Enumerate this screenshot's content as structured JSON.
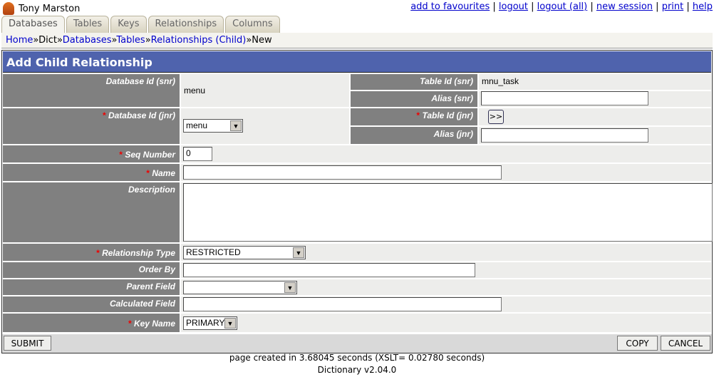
{
  "user": {
    "name": "Tony Marston"
  },
  "top_links": [
    "add to favourites",
    "logout",
    "logout (all)",
    "new session",
    "print",
    "help"
  ],
  "tabs": [
    "Databases",
    "Tables",
    "Keys",
    "Relationships",
    "Columns"
  ],
  "breadcrumb": {
    "home": "Home",
    "dict": "Dict",
    "databases": "Databases",
    "tables": "Tables",
    "relationships": "Relationships (Child)",
    "current": "New",
    "sep": "»"
  },
  "title": "Add Child Relationship",
  "form": {
    "db_snr_label": "Database Id (snr)",
    "db_snr_value": "menu",
    "table_snr_label": "Table Id (snr)",
    "table_snr_value": "mnu_task",
    "alias_snr_label": "Alias (snr)",
    "alias_snr_value": "",
    "db_jnr_label": "Database Id (jnr)",
    "db_jnr_value": "menu",
    "table_jnr_label": "Table Id (jnr)",
    "table_jnr_button": ">>",
    "alias_jnr_label": "Alias (jnr)",
    "alias_jnr_value": "",
    "seq_label": "Seq Number",
    "seq_value": "0",
    "name_label": "Name",
    "name_value": "",
    "desc_label": "Description",
    "desc_value": "",
    "reltype_label": "Relationship Type",
    "reltype_value": "RESTRICTED",
    "orderby_label": "Order By",
    "orderby_value": "",
    "parent_label": "Parent Field",
    "parent_value": "",
    "calc_label": "Calculated Field",
    "calc_value": "",
    "key_label": "Key Name",
    "key_value": "PRIMARY",
    "required_mark": "*"
  },
  "actions": {
    "submit": "SUBMIT",
    "copy": "COPY",
    "cancel": "CANCEL"
  },
  "footer": {
    "timing": "page created in 3.68045 seconds (XSLT= 0.02780 seconds)",
    "version": "Dictionary v2.04.0"
  }
}
